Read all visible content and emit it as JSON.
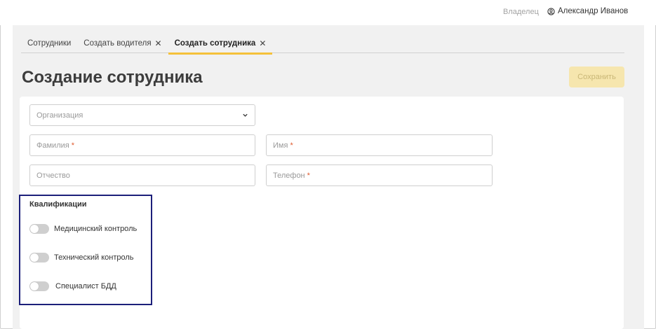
{
  "header": {
    "role": "Владелец",
    "user_name": "Александр Иванов",
    "user_icon": "user-pin-icon"
  },
  "tabs": [
    {
      "label": "Сотрудники",
      "closable": false,
      "active": false
    },
    {
      "label": "Создать водителя",
      "closable": true,
      "active": false
    },
    {
      "label": "Создать сотрудника",
      "closable": true,
      "active": true
    }
  ],
  "page": {
    "title": "Создание сотрудника",
    "save_label": "Сохранить"
  },
  "form": {
    "organization_placeholder": "Организация",
    "lastname_placeholder": "Фамилия",
    "firstname_placeholder": "Имя",
    "middlename_placeholder": "Отчество",
    "phone_placeholder": "Телефон",
    "required_mark": "*"
  },
  "qualifications": {
    "title": "Квалификации",
    "items": [
      {
        "label": "Медицинский контроль",
        "enabled": false
      },
      {
        "label": "Технический контроль",
        "enabled": false
      },
      {
        "label": "Специалист БДД",
        "enabled": false
      }
    ]
  },
  "colors": {
    "accent": "#f5c13a",
    "save_disabled_bg": "#f6e6ae",
    "highlight_border": "#1c1f7a",
    "required": "#e05a2e"
  }
}
